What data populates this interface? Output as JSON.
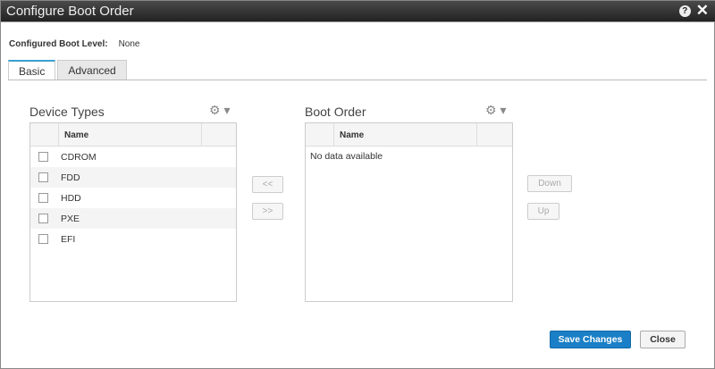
{
  "window": {
    "title": "Configure Boot Order",
    "help_icon": "?",
    "close_icon": "✕"
  },
  "boot_level": {
    "label": "Configured Boot Level:",
    "value": "None"
  },
  "tabs": [
    {
      "label": "Basic"
    },
    {
      "label": "Advanced"
    }
  ],
  "device_types": {
    "title": "Device Types",
    "column": "Name",
    "items": [
      "CDROM",
      "FDD",
      "HDD",
      "PXE",
      "EFI"
    ]
  },
  "boot_order": {
    "title": "Boot Order",
    "column": "Name",
    "empty": "No data available"
  },
  "buttons": {
    "remove": "<<",
    "add": ">>",
    "down": "Down",
    "up": "Up",
    "save": "Save Changes",
    "close": "Close"
  },
  "gear_icon": "⚙ ▾"
}
